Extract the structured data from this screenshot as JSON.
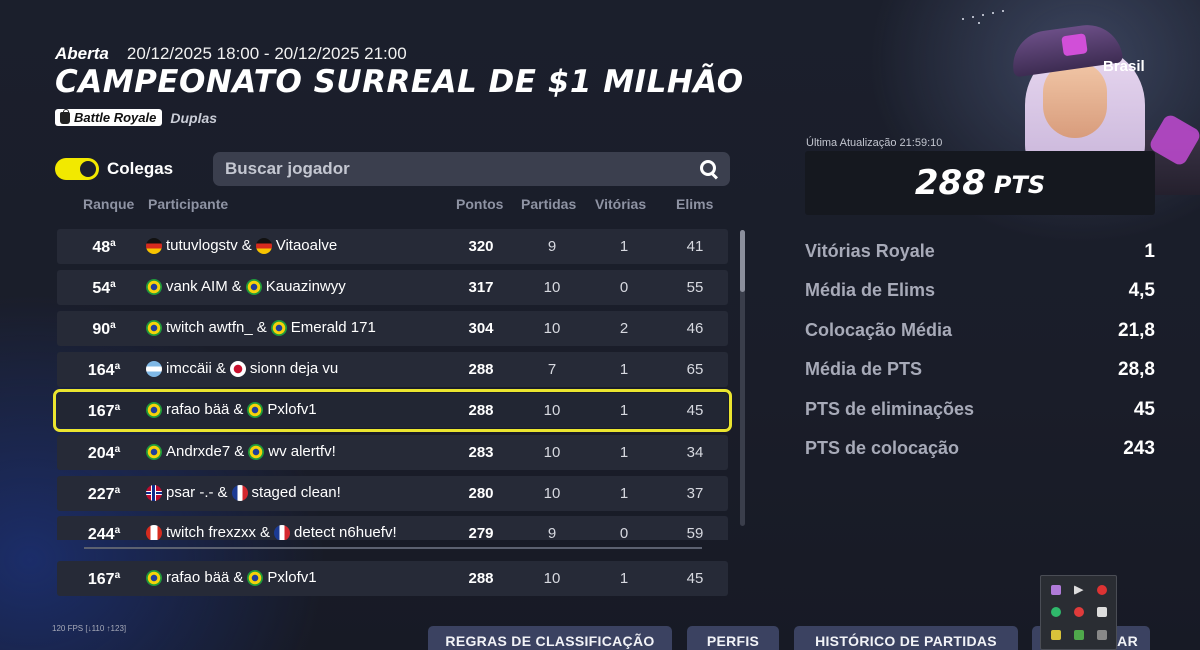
{
  "header": {
    "status": "Aberta",
    "dates": "20/12/2025 18:00 - 20/12/2025 21:00",
    "title": "CAMPEONATO SURREAL DE $1 MILHÃO",
    "mode_badge": "Battle Royale",
    "mode_type": "Duplas"
  },
  "filter": {
    "toggle_label": "Colegas",
    "toggle_on": true,
    "search_placeholder": "Buscar jogador"
  },
  "table": {
    "columns": {
      "rank": "Ranque",
      "participant": "Participante",
      "points": "Pontos",
      "matches": "Partidas",
      "wins": "Vitórias",
      "elims": "Elims"
    },
    "rank_suffix": "a",
    "rows": [
      {
        "rank": "48",
        "p1": "tutuvlogstv",
        "f1": "de",
        "p2": "Vitaoalve",
        "f2": "de",
        "points": "320",
        "matches": "9",
        "wins": "1",
        "elims": "41"
      },
      {
        "rank": "54",
        "p1": "vank AIM",
        "f1": "br",
        "p2": "Kauazinwyy",
        "f2": "br",
        "points": "317",
        "matches": "10",
        "wins": "0",
        "elims": "55"
      },
      {
        "rank": "90",
        "p1": "twitch awtfn_",
        "f1": "br",
        "p2": "Emerald 171",
        "f2": "br",
        "points": "304",
        "matches": "10",
        "wins": "2",
        "elims": "46"
      },
      {
        "rank": "164",
        "p1": "imccäii",
        "f1": "ar",
        "p2": "sionn deja vu",
        "f2": "jp",
        "points": "288",
        "matches": "7",
        "wins": "1",
        "elims": "65"
      },
      {
        "rank": "167",
        "p1": "rafao bää",
        "f1": "br",
        "p2": "Pxlofv1",
        "f2": "br",
        "points": "288",
        "matches": "10",
        "wins": "1",
        "elims": "45",
        "highlight": true
      },
      {
        "rank": "204",
        "p1": "Andrxde7",
        "f1": "br",
        "p2": "wv alertfv!",
        "f2": "br",
        "points": "283",
        "matches": "10",
        "wins": "1",
        "elims": "34"
      },
      {
        "rank": "227",
        "p1": "psar -.-",
        "f1": "no",
        "p2": "staged clean!",
        "f2": "fr",
        "points": "280",
        "matches": "10",
        "wins": "1",
        "elims": "37"
      },
      {
        "rank": "244",
        "p1": "twitch frexzxx",
        "f1": "ca",
        "p2": "detect n6huefv!",
        "f2": "fr",
        "points": "279",
        "matches": "9",
        "wins": "0",
        "elims": "59"
      }
    ],
    "own_row": {
      "rank": "167",
      "p1": "rafao bää",
      "f1": "br",
      "p2": "Pxlofv1",
      "f2": "br",
      "points": "288",
      "matches": "10",
      "wins": "1",
      "elims": "45"
    },
    "joiner": "&"
  },
  "player": {
    "country": "Brasil",
    "last_update": "Última Atualização 21:59:10",
    "points": "288",
    "points_unit": "PTS",
    "stats": [
      {
        "label": "Vitórias Royale",
        "value": "1"
      },
      {
        "label": "Média de Elims",
        "value": "4,5"
      },
      {
        "label": "Colocação Média",
        "value": "21,8"
      },
      {
        "label": "Média de PTS",
        "value": "28,8"
      },
      {
        "label": "PTS de eliminações",
        "value": "45"
      },
      {
        "label": "PTS de colocação",
        "value": "243"
      }
    ]
  },
  "footer": {
    "fps": "120 FPS [↓110 ↑123]",
    "buttons": [
      "REGRAS DE CLASSIFICAÇÃO",
      "PERFIS",
      "HISTÓRICO DE PARTIDAS",
      "...AR"
    ]
  },
  "tray_icons": [
    "feather-icon",
    "cursor-icon",
    "x-icon",
    "green-dot-icon",
    "shield-icon",
    "lock-icon",
    "battery-icon",
    "nvidia-icon",
    "device-icon"
  ]
}
